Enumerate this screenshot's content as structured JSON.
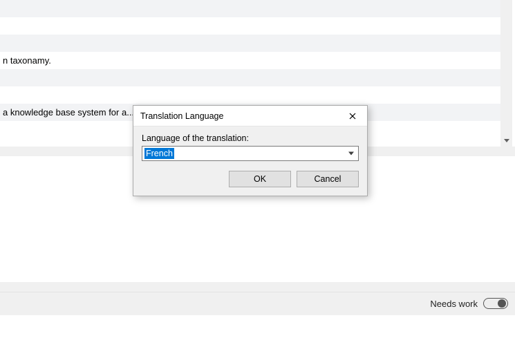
{
  "list": {
    "rows": [
      "",
      "",
      "",
      "n taxonamy.",
      "",
      "",
      "a knowledge base system for a...",
      ""
    ]
  },
  "dialog": {
    "title": "Translation Language",
    "label": "Language of the translation:",
    "value": "French",
    "ok_label": "OK",
    "cancel_label": "Cancel"
  },
  "statusbar": {
    "needs_work_label": "Needs work"
  }
}
